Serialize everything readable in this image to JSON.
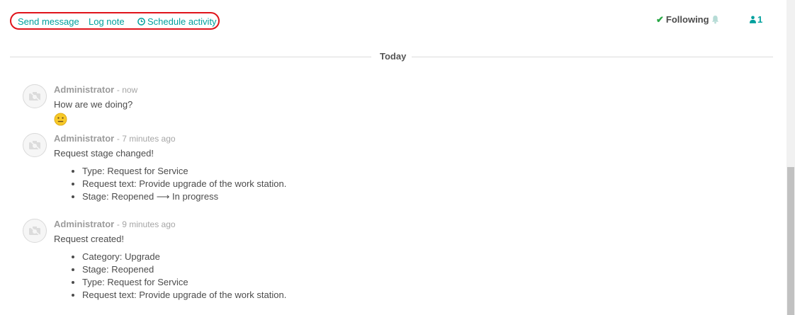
{
  "actions": {
    "send_message": "Send message",
    "log_note": "Log note",
    "schedule_activity": "Schedule activity"
  },
  "follow": {
    "following_label": "Following",
    "followers_count": "1"
  },
  "separator": {
    "label": "Today"
  },
  "messages": [
    {
      "author": "Administrator",
      "when": "- now",
      "body": "How are we doing?",
      "emoji": "neutral-face"
    },
    {
      "author": "Administrator",
      "when": "- 7 minutes ago",
      "body": "Request stage changed!",
      "changes": [
        "Type: Request for Service",
        "Request text: Provide upgrade of the work station.",
        "Stage: Reopened ⟶ In progress"
      ]
    },
    {
      "author": "Administrator",
      "when": "- 9 minutes ago",
      "body": "Request created!",
      "changes": [
        "Category: Upgrade",
        "Stage: Reopened",
        "Type: Request for Service",
        "Request text: Provide upgrade of the work station."
      ]
    }
  ],
  "colors": {
    "accent": "#00a09d",
    "highlight_border": "#e0141b",
    "check": "#28a745"
  }
}
